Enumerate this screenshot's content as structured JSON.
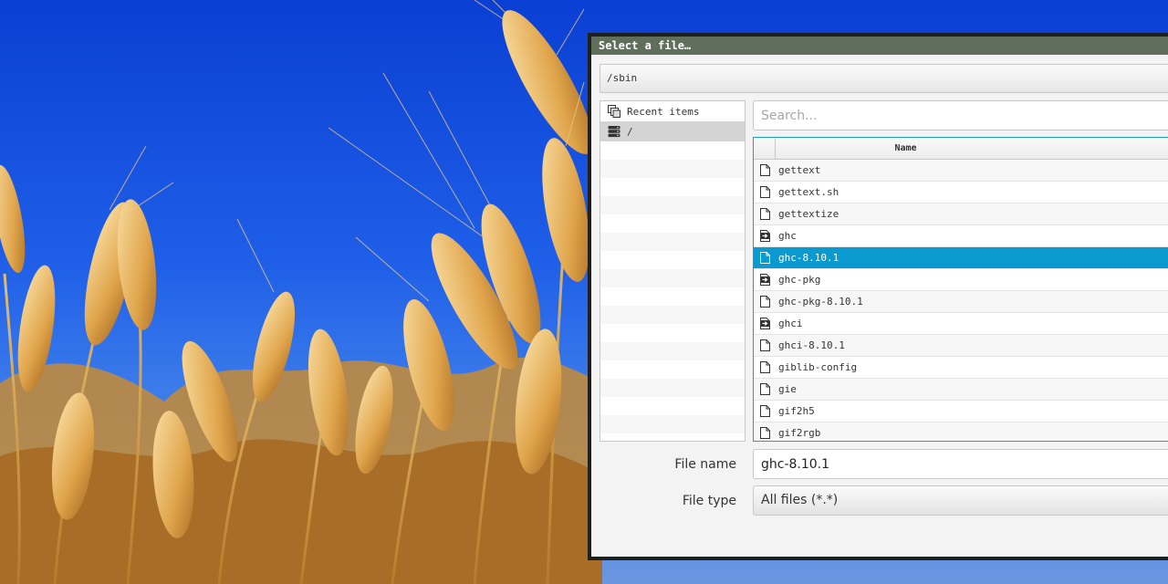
{
  "dialog": {
    "title": "Select a file…",
    "path": "/sbin"
  },
  "sidebar": {
    "items": [
      {
        "label": "Recent items",
        "icon": "recent-items-icon"
      },
      {
        "label": "/",
        "icon": "drive-icon",
        "selected": true
      }
    ]
  },
  "search": {
    "placeholder": "Search..."
  },
  "file_list": {
    "column_header": "Name",
    "rows": [
      {
        "name": "gettext",
        "icon": "file-icon"
      },
      {
        "name": "gettext.sh",
        "icon": "file-icon"
      },
      {
        "name": "gettextize",
        "icon": "file-icon"
      },
      {
        "name": "ghc",
        "icon": "symlink-icon"
      },
      {
        "name": "ghc-8.10.1",
        "icon": "file-icon",
        "selected": true
      },
      {
        "name": "ghc-pkg",
        "icon": "symlink-icon"
      },
      {
        "name": "ghc-pkg-8.10.1",
        "icon": "file-icon"
      },
      {
        "name": "ghci",
        "icon": "symlink-icon"
      },
      {
        "name": "ghci-8.10.1",
        "icon": "file-icon"
      },
      {
        "name": "giblib-config",
        "icon": "file-icon"
      },
      {
        "name": "gie",
        "icon": "file-icon"
      },
      {
        "name": "gif2h5",
        "icon": "file-icon"
      },
      {
        "name": "gif2rgb",
        "icon": "file-icon"
      }
    ]
  },
  "filename": {
    "label": "File name",
    "value": "ghc-8.10.1"
  },
  "filetype": {
    "label": "File type",
    "value": "All files (*.*)"
  },
  "colors": {
    "titlebar": "#5f6f5c",
    "selection": "#0b9ad0",
    "list_focus_border": "#1b9bd1",
    "sky": "#1f5fe8",
    "wheat": "#d9a441"
  }
}
